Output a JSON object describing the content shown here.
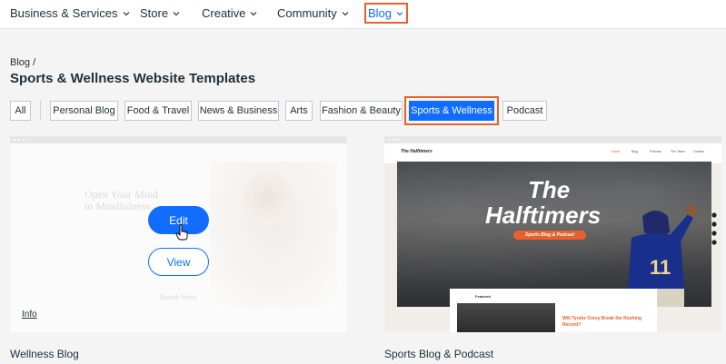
{
  "nav": {
    "items": [
      {
        "label": "Business & Services"
      },
      {
        "label": "Store"
      },
      {
        "label": "Creative"
      },
      {
        "label": "Community"
      },
      {
        "label": "Blog"
      }
    ]
  },
  "breadcrumb": "Blog /",
  "page_title": "Sports & Wellness Website Templates",
  "filters": [
    {
      "label": "All"
    },
    {
      "label": "Personal Blog"
    },
    {
      "label": "Food & Travel"
    },
    {
      "label": "News & Business"
    },
    {
      "label": "Arts"
    },
    {
      "label": "Fashion & Beauty"
    },
    {
      "label": "Sports & Wellness"
    },
    {
      "label": "Podcast"
    }
  ],
  "templates": [
    {
      "name": "Wellness Blog",
      "edit_label": "Edit",
      "view_label": "View",
      "info_label": "Info",
      "preview_heading": "Open Your Mind to Mindfulness",
      "preview_caption": "Breath Work"
    },
    {
      "name": "Sports Blog & Podcast",
      "preview": {
        "brand": "The Halftimers",
        "menu": [
          "Home",
          "Blog",
          "Podcast",
          "The Team",
          "Contact"
        ],
        "hero_line1": "The",
        "hero_line2": "Halftimers",
        "tagline": "Sports Blog & Podcast",
        "jersey_number": "11",
        "featured_label": "Featured",
        "featured_title": "Will Tyreke Corey Break the Rushing Record?"
      }
    }
  ],
  "colors": {
    "accent": "#116dff",
    "highlight": "#e8612c",
    "text": "#20303c",
    "page_bg": "#f4f4f4"
  }
}
